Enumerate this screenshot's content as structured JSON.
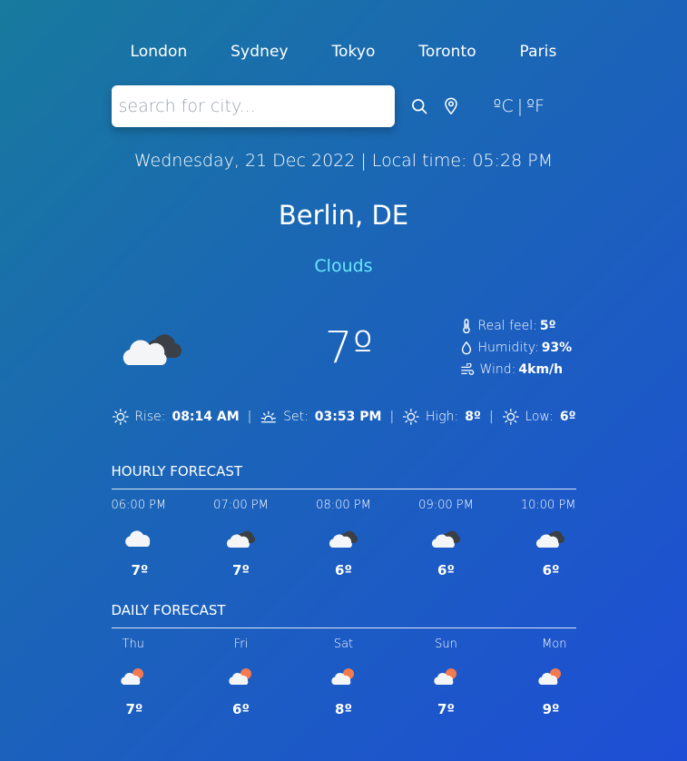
{
  "nav": {
    "cities": [
      "London",
      "Sydney",
      "Tokyo",
      "Toronto",
      "Paris"
    ]
  },
  "search": {
    "placeholder": "search for city...",
    "value": ""
  },
  "units": {
    "celsius": "ºC",
    "separator": "|",
    "fahrenheit": "ºF"
  },
  "datetime": "Wednesday, 21 Dec 2022 | Local time: 05:28 PM",
  "location": "Berlin, DE",
  "condition": "Clouds",
  "current": {
    "icon": "clouds-icon",
    "temperature": "7º",
    "details": {
      "real_feel_label": "Real feel:",
      "real_feel_value": "5º",
      "humidity_label": "Humidity:",
      "humidity_value": "93%",
      "wind_label": "Wind:",
      "wind_value": "4km/h"
    }
  },
  "sun": {
    "rise_label": "Rise:",
    "rise_value": "08:14 AM",
    "set_label": "Set:",
    "set_value": "03:53 PM",
    "high_label": "High:",
    "high_value": "8º",
    "low_label": "Low:",
    "low_value": "6º",
    "separator": "|"
  },
  "hourly": {
    "title": "HOURLY FORECAST",
    "items": [
      {
        "label": "06:00 PM",
        "icon": "cloud-icon",
        "temp": "7º"
      },
      {
        "label": "07:00 PM",
        "icon": "clouds-icon",
        "temp": "7º"
      },
      {
        "label": "08:00 PM",
        "icon": "clouds-icon",
        "temp": "6º"
      },
      {
        "label": "09:00 PM",
        "icon": "clouds-icon",
        "temp": "6º"
      },
      {
        "label": "10:00 PM",
        "icon": "clouds-icon",
        "temp": "6º"
      }
    ]
  },
  "daily": {
    "title": "DAILY FORECAST",
    "items": [
      {
        "label": "Thu",
        "icon": "partly-cloudy-icon",
        "temp": "7º"
      },
      {
        "label": "Fri",
        "icon": "partly-cloudy-icon",
        "temp": "6º"
      },
      {
        "label": "Sat",
        "icon": "partly-cloudy-icon",
        "temp": "8º"
      },
      {
        "label": "Sun",
        "icon": "partly-cloudy-icon",
        "temp": "7º"
      },
      {
        "label": "Mon",
        "icon": "partly-cloudy-icon",
        "temp": "9º"
      }
    ]
  },
  "colors": {
    "accent_condition": "#67e8f9",
    "bg_start": "#187a9e",
    "bg_end": "#1e4ed6"
  }
}
